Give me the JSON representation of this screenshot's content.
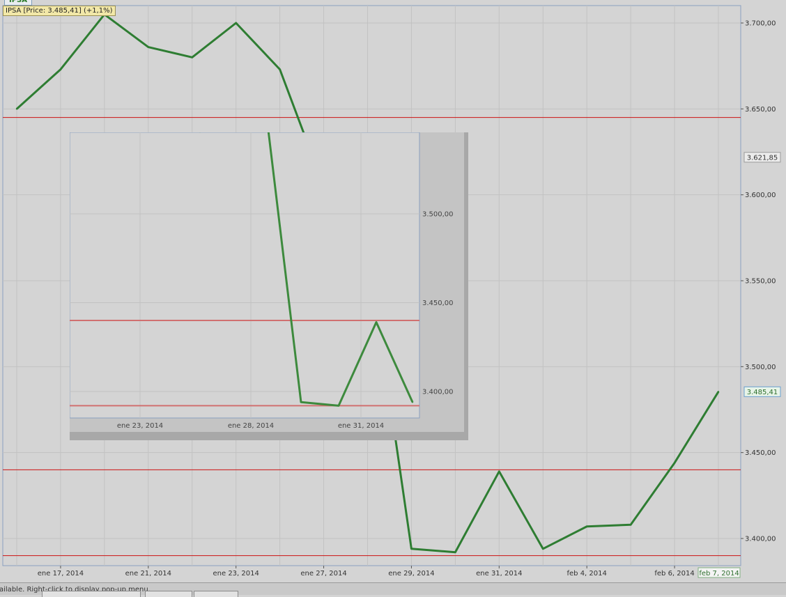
{
  "window": {
    "tab_label": "IPSA",
    "series_tag": "IPSA [Price: 3.485,41] (+1,1%)",
    "status_text": "ailable. Right-click to display pop-up menu."
  },
  "colors": {
    "line": "#2e7d32",
    "h_line": "#cc1111",
    "grid": "#c2c2c2",
    "frame": "#8aa0c0",
    "background": "#d4d4d4"
  },
  "chart_data": [
    {
      "type": "line",
      "title": "",
      "series": [
        {
          "name": "IPSA",
          "x": [
            "ene 16, 2014",
            "ene 17, 2014",
            "ene 20, 2014",
            "ene 21, 2014",
            "ene 22, 2014",
            "ene 23, 2014",
            "ene 24, 2014",
            "ene 27, 2014",
            "ene 28, 2014",
            "ene 29, 2014",
            "ene 30, 2014",
            "ene 31, 2014",
            "feb 3, 2014",
            "feb 4, 2014",
            "feb 5, 2014",
            "feb 6, 2014",
            "feb 7, 2014"
          ],
          "values": [
            3650,
            3673,
            3705,
            3686,
            3680,
            3700,
            3673,
            3605,
            3570,
            3394,
            3392,
            3439,
            3394,
            3407,
            3408,
            3444,
            3485.41
          ]
        }
      ],
      "x_tick_labels": [
        "ene 17, 2014",
        "ene 21, 2014",
        "ene 23, 2014",
        "ene 27, 2014",
        "ene 29, 2014",
        "ene 31, 2014",
        "feb 4, 2014",
        "feb 6, 2014"
      ],
      "x_last_label": "feb 7, 2014",
      "y_ticks": [
        "3.400,00",
        "3.450,00",
        "3.500,00",
        "3.550,00",
        "3.600,00",
        "3.650,00",
        "3.700,00"
      ],
      "y_tick_values": [
        3400,
        3450,
        3500,
        3550,
        3600,
        3650,
        3700
      ],
      "ylim": [
        3385,
        3710
      ],
      "h_lines": [
        3645,
        3440,
        3390
      ],
      "price_labels": [
        {
          "value": 3621.85,
          "text": "3.621,85"
        },
        {
          "value": 3485.41,
          "text": "3.485,41"
        }
      ],
      "grid": true
    },
    {
      "type": "line",
      "title": "",
      "series": [
        {
          "name": "IPSA",
          "x": [
            "ene 27, 2014",
            "ene 28, 2014",
            "ene 29, 2014",
            "ene 30, 2014",
            "ene 31, 2014",
            "feb 3, 2014"
          ],
          "values": [
            3605,
            3570,
            3394,
            3392,
            3439,
            3394
          ]
        }
      ],
      "x_tick_labels": [
        "ene 23, 2014",
        "ene 28, 2014",
        "ene 31, 2014"
      ],
      "y_ticks": [
        "3.400,00",
        "3.450,00",
        "3.500,00"
      ],
      "y_tick_values": [
        3400,
        3450,
        3500
      ],
      "h_lines": [
        3440,
        3392
      ],
      "grid": true
    }
  ]
}
